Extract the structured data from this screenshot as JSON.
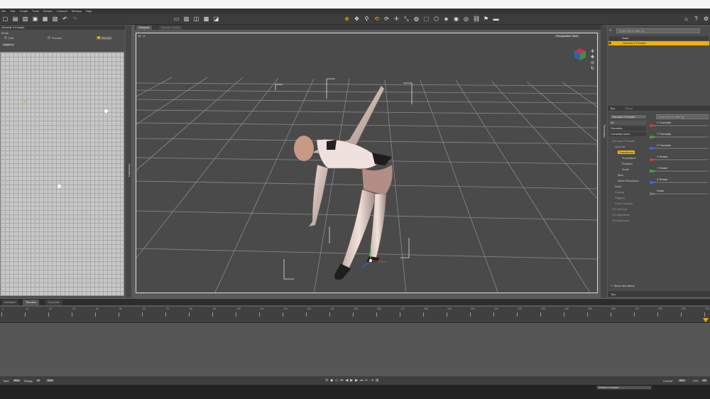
{
  "menu": [
    "File",
    "Edit",
    "Create",
    "Tools",
    "Render",
    "Connect",
    "Window",
    "Help"
  ],
  "left_panel": {
    "title": "Genesis 3 Female",
    "mode_label": "Mode",
    "modes": [
      "Edit",
      "Preview",
      "Record"
    ],
    "selected_mode": "Record",
    "layer_dropdown": "Layer 1"
  },
  "left_vtabs": [
    "",
    "",
    "",
    "Parameters"
  ],
  "viewport": {
    "tabs": [
      "Viewport",
      "Render Library"
    ],
    "view_selector": "Perspective View",
    "corner_label": "40 : 0"
  },
  "scene": {
    "search_placeholder": "Enter text to filter by",
    "header_label": "Node",
    "selected_node": "Genesis 3 Female",
    "tabs": [
      "Tips",
      "Scene"
    ]
  },
  "parameters": {
    "node_dropdown": "Genesis 3 Female",
    "search_placeholder": "Enter text to filter by",
    "groups": [
      "All",
      "Favorites",
      "Currently Used"
    ],
    "tree": [
      {
        "label": "Genesis 3 Female",
        "indent": 0
      },
      {
        "label": "General",
        "indent": 1
      },
      {
        "label": "Transforms",
        "indent": 2,
        "selected": true
      },
      {
        "label": "Translation",
        "indent": 3
      },
      {
        "label": "Rotation",
        "indent": 3
      },
      {
        "label": "Scale",
        "indent": 3
      },
      {
        "label": "Misc",
        "indent": 2
      },
      {
        "label": "Mesh Resolution",
        "indent": 2
      },
      {
        "label": "Actor",
        "indent": 1
      },
      {
        "label": "Display",
        "indent": 1
      },
      {
        "label": "Rigging",
        "indent": 1
      },
      {
        "label": "Pose Controls",
        "indent": 1
      },
      {
        "label": "G3 Left Eye",
        "indent": 0
      },
      {
        "label": "G3 Eyelashes",
        "indent": 0
      },
      {
        "label": "G3 Eyebrows",
        "indent": 0
      }
    ],
    "params": [
      {
        "label": "X Translate",
        "color": "#b94a4a"
      },
      {
        "label": "Y Translate",
        "color": "#4aa04a"
      },
      {
        "label": "Z Translate",
        "color": "#4a6ad0"
      },
      {
        "label": "X Rotate",
        "color": "#b94a4a"
      },
      {
        "label": "Y Rotate",
        "color": "#4aa04a"
      },
      {
        "label": "Z Rotate",
        "color": "#4a6ad0"
      },
      {
        "label": "Scale",
        "color": "#777777"
      }
    ],
    "show_sub_items": "Show Sub Items",
    "bottom_tab": "Tips"
  },
  "timeline": {
    "tabs": [
      "aniMate2",
      "Timeline",
      "Keymate"
    ],
    "active_tab": "Timeline",
    "ticks": [
      0,
      10,
      20,
      30,
      40,
      50,
      60,
      70,
      80,
      90,
      100,
      110,
      120,
      130,
      140,
      150,
      160,
      170,
      180,
      190,
      200,
      210,
      220,
      230,
      240,
      250,
      260,
      270,
      280,
      290,
      300
    ]
  },
  "status": {
    "total_label": "Total",
    "total_value": "300",
    "range_label": "Range",
    "range_start": "0",
    "range_end": "300",
    "current_label": "Current",
    "current_value": "300",
    "fps_label": "FPS",
    "fps_value": "30"
  },
  "lesson_dropdown": "Select a Lesson",
  "colors": {
    "accent": "#f0b100",
    "panel": "#4d4d4d",
    "toolbar": "#3c3c3c"
  }
}
